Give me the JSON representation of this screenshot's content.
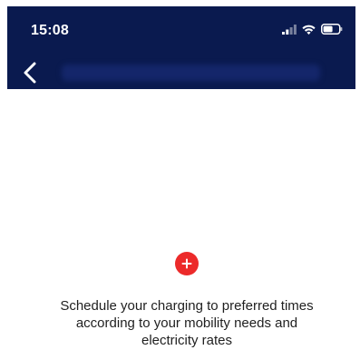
{
  "status_bar": {
    "time": "15:08",
    "icons": [
      "signal-icon",
      "wifi-icon",
      "battery-icon"
    ]
  },
  "header": {
    "back_icon": "chevron-left-icon"
  },
  "empty_state": {
    "add_icon": "plus-icon",
    "line1": "Schedule your charging to preferred times",
    "line2": "according to your mobility needs and",
    "line3": "electricity rates"
  },
  "colors": {
    "header_bg": "#0a1a4f",
    "accent_red": "#ec2a2a",
    "text": "#1f1f1f",
    "background": "#ffffff"
  }
}
